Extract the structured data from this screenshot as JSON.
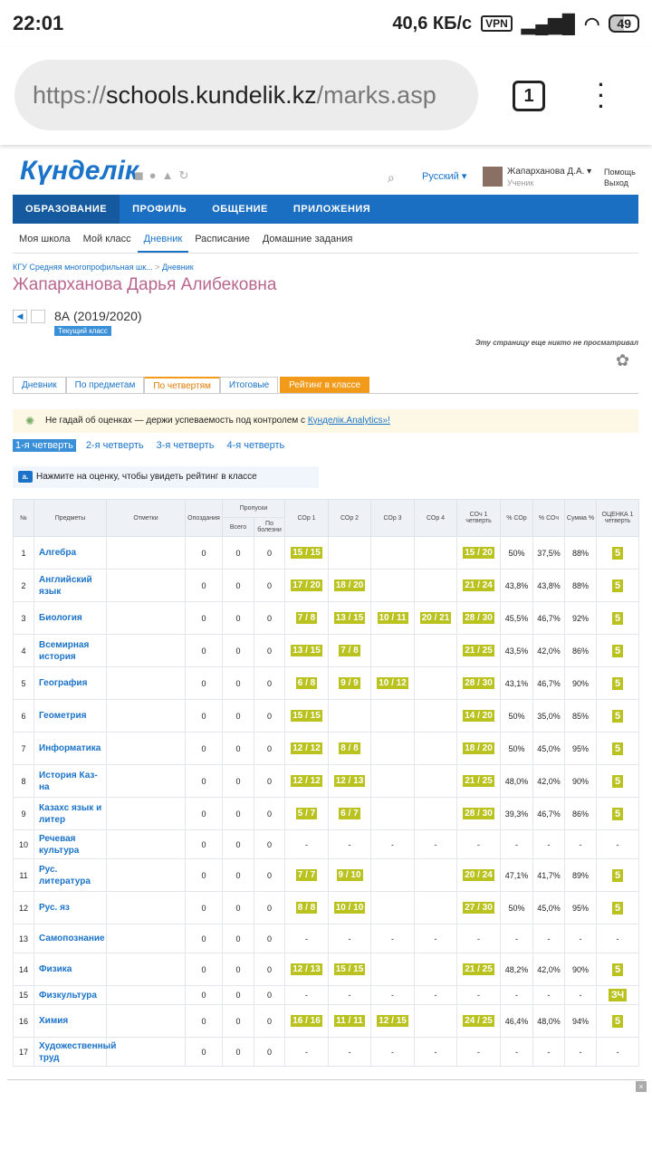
{
  "status": {
    "time": "22:01",
    "speed": "40,6 КБ/с",
    "vpn": "VPN",
    "battery": "49"
  },
  "browser": {
    "url_prefix": "https://",
    "url_host": "schools.kundelik.kz",
    "url_path": "/marks.asp",
    "tab_count": "1"
  },
  "site": {
    "logo_main": "Күнделік",
    "language": "Русский",
    "user_name": "Жапарханова Д.А.",
    "user_role": "Ученик",
    "help": "Помощь",
    "logout": "Выход"
  },
  "mainnav": [
    "ОБРАЗОВАНИЕ",
    "ПРОФИЛЬ",
    "ОБЩЕНИЕ",
    "ПРИЛОЖЕНИЯ"
  ],
  "subnav": [
    "Моя школа",
    "Мой класс",
    "Дневник",
    "Расписание",
    "Домашние задания"
  ],
  "breadcrumb": {
    "school": "КГУ Средняя многопрофильная шк...",
    "sep": ">",
    "section": "Дневник"
  },
  "student_name": "Жапарханова Дарья Алибековна",
  "class": {
    "label": "8А (2019/2020)",
    "current": "Текущий класс"
  },
  "not_viewed": "Эту страницу еще никто не просматривал",
  "tabs": [
    "Дневник",
    "По предметам",
    "По четвертям",
    "Итоговые",
    "Рейтинг в классе"
  ],
  "promo": {
    "text": "Не гадай об оценках — держи успеваемость под контролем с ",
    "link": "Күнделік.Analytics»!"
  },
  "quarters": [
    "1-я четверть",
    "2-я четверть",
    "3-я четверть",
    "4-я четверть"
  ],
  "hint": {
    "icon": "a.",
    "text": "Нажмите на оценку, чтобы увидеть рейтинг в классе"
  },
  "table_headers": {
    "n": "№",
    "subject": "Предметы",
    "marks": "Отметки",
    "late": "Опоздания",
    "absent": "Пропуски",
    "absent_total": "Всего",
    "absent_ill": "По болезни",
    "sor1": "СОр 1",
    "sor2": "СОр 2",
    "sor3": "СОр 3",
    "sor4": "СОр 4",
    "soch": "СОч 1 четверть",
    "psor": "% СОр",
    "psoch": "% СОч",
    "sum": "Сумма %",
    "grade": "ОЦЕНКА 1 четверть"
  },
  "rows": [
    {
      "n": "1",
      "subject": "Алгебра",
      "late": "0",
      "total": "0",
      "ill": "0",
      "sor": [
        "15 / 15",
        "",
        "",
        ""
      ],
      "soch": "15 / 20",
      "psor": "50%",
      "psoch": "37,5%",
      "sum": "88%",
      "grade": "5"
    },
    {
      "n": "2",
      "subject": "Английский язык",
      "late": "0",
      "total": "0",
      "ill": "0",
      "sor": [
        "17 / 20",
        "18 / 20",
        "",
        ""
      ],
      "soch": "21 / 24",
      "psor": "43,8%",
      "psoch": "43,8%",
      "sum": "88%",
      "grade": "5"
    },
    {
      "n": "3",
      "subject": "Биология",
      "late": "0",
      "total": "0",
      "ill": "0",
      "sor": [
        "7 / 8",
        "13 / 15",
        "10 / 11",
        "20 / 21"
      ],
      "soch": "28 / 30",
      "psor": "45,5%",
      "psoch": "46,7%",
      "sum": "92%",
      "grade": "5"
    },
    {
      "n": "4",
      "subject": "Всемирная история",
      "late": "0",
      "total": "0",
      "ill": "0",
      "sor": [
        "13 / 15",
        "7 / 8",
        "",
        ""
      ],
      "soch": "21 / 25",
      "psor": "43,5%",
      "psoch": "42,0%",
      "sum": "86%",
      "grade": "5"
    },
    {
      "n": "5",
      "subject": "География",
      "late": "0",
      "total": "0",
      "ill": "0",
      "sor": [
        "6 / 8",
        "9 / 9",
        "10 / 12",
        ""
      ],
      "soch": "28 / 30",
      "psor": "43,1%",
      "psoch": "46,7%",
      "sum": "90%",
      "grade": "5"
    },
    {
      "n": "6",
      "subject": "Геометрия",
      "late": "0",
      "total": "0",
      "ill": "0",
      "sor": [
        "15 / 15",
        "",
        "",
        ""
      ],
      "soch": "14 / 20",
      "psor": "50%",
      "psoch": "35,0%",
      "sum": "85%",
      "grade": "5"
    },
    {
      "n": "7",
      "subject": "Информатика",
      "late": "0",
      "total": "0",
      "ill": "0",
      "sor": [
        "12 / 12",
        "8 / 8",
        "",
        ""
      ],
      "soch": "18 / 20",
      "psor": "50%",
      "psoch": "45,0%",
      "sum": "95%",
      "grade": "5"
    },
    {
      "n": "8",
      "subject": "История Каз-на",
      "late": "0",
      "total": "0",
      "ill": "0",
      "sor": [
        "12 / 12",
        "12 / 13",
        "",
        ""
      ],
      "soch": "21 / 25",
      "psor": "48,0%",
      "psoch": "42,0%",
      "sum": "90%",
      "grade": "5"
    },
    {
      "n": "9",
      "subject": "Казахс язык и литер",
      "late": "0",
      "total": "0",
      "ill": "0",
      "sor": [
        "5 / 7",
        "6 / 7",
        "",
        ""
      ],
      "soch": "28 / 30",
      "psor": "39,3%",
      "psoch": "46,7%",
      "sum": "86%",
      "grade": "5"
    },
    {
      "n": "10",
      "subject": "Речевая культура",
      "late": "0",
      "total": "0",
      "ill": "0",
      "sor": [
        "-",
        "-",
        "-",
        "-"
      ],
      "soch": "-",
      "psor": "-",
      "psoch": "-",
      "sum": "-",
      "grade": "-"
    },
    {
      "n": "11",
      "subject": "Рус. литература",
      "late": "0",
      "total": "0",
      "ill": "0",
      "sor": [
        "7 / 7",
        "9 / 10",
        "",
        ""
      ],
      "soch": "20 / 24",
      "psor": "47,1%",
      "psoch": "41,7%",
      "sum": "89%",
      "grade": "5"
    },
    {
      "n": "12",
      "subject": "Рус. яз",
      "late": "0",
      "total": "0",
      "ill": "0",
      "sor": [
        "8 / 8",
        "10 / 10",
        "",
        ""
      ],
      "soch": "27 / 30",
      "psor": "50%",
      "psoch": "45,0%",
      "sum": "95%",
      "grade": "5"
    },
    {
      "n": "13",
      "subject": "Самопознание",
      "late": "0",
      "total": "0",
      "ill": "0",
      "sor": [
        "-",
        "-",
        "-",
        "-"
      ],
      "soch": "-",
      "psor": "-",
      "psoch": "-",
      "sum": "-",
      "grade": "-"
    },
    {
      "n": "14",
      "subject": "Физика",
      "late": "0",
      "total": "0",
      "ill": "0",
      "sor": [
        "12 / 13",
        "15 / 15",
        "",
        ""
      ],
      "soch": "21 / 25",
      "psor": "48,2%",
      "psoch": "42,0%",
      "sum": "90%",
      "grade": "5"
    },
    {
      "n": "15",
      "subject": "Физкультура",
      "late": "0",
      "total": "0",
      "ill": "0",
      "sor": [
        "-",
        "-",
        "-",
        "-"
      ],
      "soch": "-",
      "psor": "-",
      "psoch": "-",
      "sum": "-",
      "grade": "ЗЧ"
    },
    {
      "n": "16",
      "subject": "Химия",
      "late": "0",
      "total": "0",
      "ill": "0",
      "sor": [
        "16 / 16",
        "11 / 11",
        "12 / 15",
        ""
      ],
      "soch": "24 / 25",
      "psor": "46,4%",
      "psoch": "48,0%",
      "sum": "94%",
      "grade": "5"
    },
    {
      "n": "17",
      "subject": "Художественный труд",
      "late": "0",
      "total": "0",
      "ill": "0",
      "sor": [
        "-",
        "-",
        "-",
        "-"
      ],
      "soch": "-",
      "psor": "-",
      "psoch": "-",
      "sum": "-",
      "grade": "-"
    }
  ]
}
